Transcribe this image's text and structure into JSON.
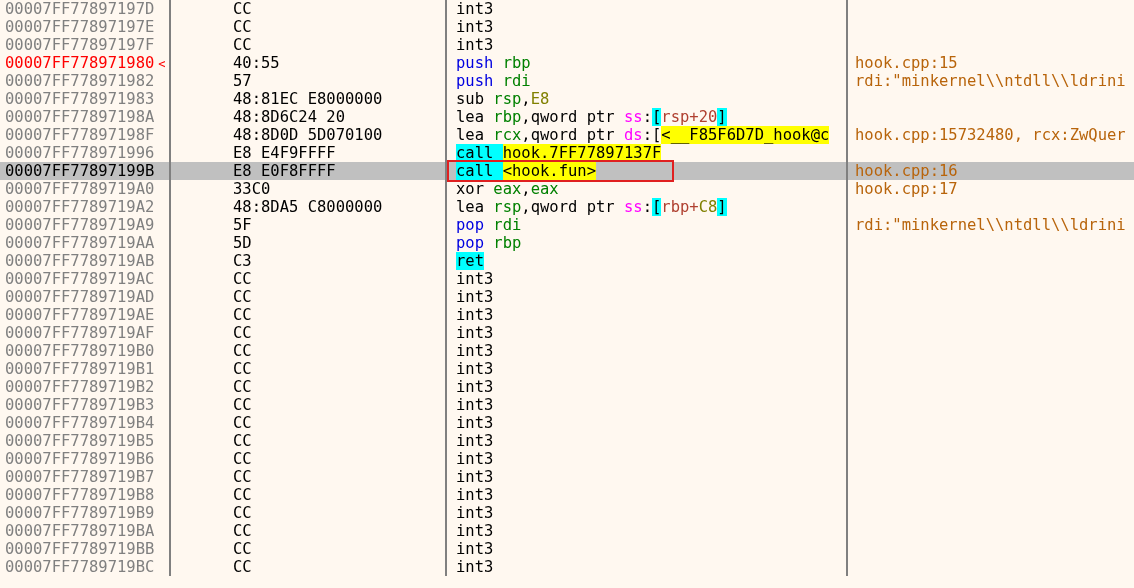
{
  "rows": [
    {
      "address": "00007FF77897197D",
      "bytes": "CC",
      "instruction": [
        {
          "text": "int3",
          "kind": "op"
        }
      ],
      "selected": false,
      "highlighted": false
    },
    {
      "address": "00007FF77897197E",
      "bytes": "CC",
      "instruction": [
        {
          "text": "int3",
          "kind": "op"
        }
      ],
      "selected": false,
      "highlighted": false
    },
    {
      "address": "00007FF77897197F",
      "bytes": "CC",
      "instruction": [
        {
          "text": "int3",
          "kind": "op"
        }
      ],
      "selected": false,
      "highlighted": false
    },
    {
      "address": "00007FF778971980",
      "marker": "<",
      "bytes": "40:55",
      "instruction": [
        {
          "text": "push ",
          "kind": "stack"
        },
        {
          "text": "rbp",
          "kind": "reg"
        }
      ],
      "comment": "hook.cpp:15",
      "selected": false,
      "highlighted": true
    },
    {
      "address": "00007FF778971982",
      "bytes": "57",
      "instruction": [
        {
          "text": "push ",
          "kind": "stack"
        },
        {
          "text": "rdi",
          "kind": "reg"
        }
      ],
      "comment": "rdi:\"minkernel\\\\ntdll\\\\ldrini",
      "selected": false,
      "highlighted": false
    },
    {
      "address": "00007FF778971983",
      "bytes": "48:81EC E8000000",
      "instruction": [
        {
          "text": "sub ",
          "kind": "op"
        },
        {
          "text": "rsp",
          "kind": "reg"
        },
        {
          "text": ",",
          "kind": "op"
        },
        {
          "text": "E8",
          "kind": "imm"
        }
      ],
      "selected": false,
      "highlighted": false
    },
    {
      "address": "00007FF77897198A",
      "bytes": "48:8D6C24 20",
      "instruction": [
        {
          "text": "lea ",
          "kind": "op"
        },
        {
          "text": "rbp",
          "kind": "reg"
        },
        {
          "text": ",qword ptr ",
          "kind": "op"
        },
        {
          "text": "ss",
          "kind": "seg"
        },
        {
          "text": ":",
          "kind": "op"
        },
        {
          "text": "[",
          "kind": "br"
        },
        {
          "text": "rsp+20",
          "kind": "mem"
        },
        {
          "text": "]",
          "kind": "br"
        }
      ],
      "selected": false,
      "highlighted": false
    },
    {
      "address": "00007FF77897198F",
      "bytes": "48:8D0D 5D070100",
      "instruction": [
        {
          "text": "lea ",
          "kind": "op"
        },
        {
          "text": "rcx",
          "kind": "reg"
        },
        {
          "text": ",qword ptr ",
          "kind": "op"
        },
        {
          "text": "ds",
          "kind": "seg"
        },
        {
          "text": ":[",
          "kind": "op"
        },
        {
          "text": "<__F85F6D7D_hook@c",
          "kind": "sym"
        }
      ],
      "comment": "hook.cpp:15732480, rcx:ZwQuer",
      "selected": false,
      "highlighted": false
    },
    {
      "address": "00007FF778971996",
      "bytes": "E8 E4F9FFFF",
      "instruction": [
        {
          "text": "call ",
          "kind": "branch"
        },
        {
          "text": "hook.7FF77897137F",
          "kind": "sym"
        }
      ],
      "selected": false,
      "highlighted": false
    },
    {
      "address": "00007FF77897199B",
      "bytes": "E8 E0F8FFFF",
      "instruction": [
        {
          "text": "call ",
          "kind": "branch"
        },
        {
          "text": "<hook.fun>",
          "kind": "sym"
        }
      ],
      "comment": "hook.cpp:16",
      "selected": true,
      "highlighted": false,
      "framed": true
    },
    {
      "address": "00007FF7789719A0",
      "bytes": "33C0",
      "instruction": [
        {
          "text": "xor ",
          "kind": "op"
        },
        {
          "text": "eax",
          "kind": "reg"
        },
        {
          "text": ",",
          "kind": "op"
        },
        {
          "text": "eax",
          "kind": "reg"
        }
      ],
      "comment": "hook.cpp:17",
      "selected": false,
      "highlighted": false
    },
    {
      "address": "00007FF7789719A2",
      "bytes": "48:8DA5 C8000000",
      "instruction": [
        {
          "text": "lea ",
          "kind": "op"
        },
        {
          "text": "rsp",
          "kind": "reg"
        },
        {
          "text": ",qword ptr ",
          "kind": "op"
        },
        {
          "text": "ss",
          "kind": "seg"
        },
        {
          "text": ":",
          "kind": "op"
        },
        {
          "text": "[",
          "kind": "br"
        },
        {
          "text": "rbp+",
          "kind": "mem"
        },
        {
          "text": "C8",
          "kind": "imm"
        },
        {
          "text": "]",
          "kind": "br"
        }
      ],
      "selected": false,
      "highlighted": false
    },
    {
      "address": "00007FF7789719A9",
      "bytes": "5F",
      "instruction": [
        {
          "text": "pop ",
          "kind": "stack"
        },
        {
          "text": "rdi",
          "kind": "reg"
        }
      ],
      "comment": "rdi:\"minkernel\\\\ntdll\\\\ldrini",
      "selected": false,
      "highlighted": false
    },
    {
      "address": "00007FF7789719AA",
      "bytes": "5D",
      "instruction": [
        {
          "text": "pop ",
          "kind": "stack"
        },
        {
          "text": "rbp",
          "kind": "reg"
        }
      ],
      "selected": false,
      "highlighted": false
    },
    {
      "address": "00007FF7789719AB",
      "bytes": "C3",
      "instruction": [
        {
          "text": "ret",
          "kind": "branch"
        }
      ],
      "selected": false,
      "highlighted": false
    },
    {
      "address": "00007FF7789719AC",
      "bytes": "CC",
      "instruction": [
        {
          "text": "int3",
          "kind": "op"
        }
      ],
      "selected": false,
      "highlighted": false
    },
    {
      "address": "00007FF7789719AD",
      "bytes": "CC",
      "instruction": [
        {
          "text": "int3",
          "kind": "op"
        }
      ],
      "selected": false,
      "highlighted": false
    },
    {
      "address": "00007FF7789719AE",
      "bytes": "CC",
      "instruction": [
        {
          "text": "int3",
          "kind": "op"
        }
      ],
      "selected": false,
      "highlighted": false
    },
    {
      "address": "00007FF7789719AF",
      "bytes": "CC",
      "instruction": [
        {
          "text": "int3",
          "kind": "op"
        }
      ],
      "selected": false,
      "highlighted": false
    },
    {
      "address": "00007FF7789719B0",
      "bytes": "CC",
      "instruction": [
        {
          "text": "int3",
          "kind": "op"
        }
      ],
      "selected": false,
      "highlighted": false
    },
    {
      "address": "00007FF7789719B1",
      "bytes": "CC",
      "instruction": [
        {
          "text": "int3",
          "kind": "op"
        }
      ],
      "selected": false,
      "highlighted": false
    },
    {
      "address": "00007FF7789719B2",
      "bytes": "CC",
      "instruction": [
        {
          "text": "int3",
          "kind": "op"
        }
      ],
      "selected": false,
      "highlighted": false
    },
    {
      "address": "00007FF7789719B3",
      "bytes": "CC",
      "instruction": [
        {
          "text": "int3",
          "kind": "op"
        }
      ],
      "selected": false,
      "highlighted": false
    },
    {
      "address": "00007FF7789719B4",
      "bytes": "CC",
      "instruction": [
        {
          "text": "int3",
          "kind": "op"
        }
      ],
      "selected": false,
      "highlighted": false
    },
    {
      "address": "00007FF7789719B5",
      "bytes": "CC",
      "instruction": [
        {
          "text": "int3",
          "kind": "op"
        }
      ],
      "selected": false,
      "highlighted": false
    },
    {
      "address": "00007FF7789719B6",
      "bytes": "CC",
      "instruction": [
        {
          "text": "int3",
          "kind": "op"
        }
      ],
      "selected": false,
      "highlighted": false
    },
    {
      "address": "00007FF7789719B7",
      "bytes": "CC",
      "instruction": [
        {
          "text": "int3",
          "kind": "op"
        }
      ],
      "selected": false,
      "highlighted": false
    },
    {
      "address": "00007FF7789719B8",
      "bytes": "CC",
      "instruction": [
        {
          "text": "int3",
          "kind": "op"
        }
      ],
      "selected": false,
      "highlighted": false
    },
    {
      "address": "00007FF7789719B9",
      "bytes": "CC",
      "instruction": [
        {
          "text": "int3",
          "kind": "op"
        }
      ],
      "selected": false,
      "highlighted": false
    },
    {
      "address": "00007FF7789719BA",
      "bytes": "CC",
      "instruction": [
        {
          "text": "int3",
          "kind": "op"
        }
      ],
      "selected": false,
      "highlighted": false
    },
    {
      "address": "00007FF7789719BB",
      "bytes": "CC",
      "instruction": [
        {
          "text": "int3",
          "kind": "op"
        }
      ],
      "selected": false,
      "highlighted": false
    },
    {
      "address": "00007FF7789719BC",
      "bytes": "CC",
      "instruction": [
        {
          "text": "int3",
          "kind": "op"
        }
      ],
      "selected": false,
      "highlighted": false
    }
  ]
}
